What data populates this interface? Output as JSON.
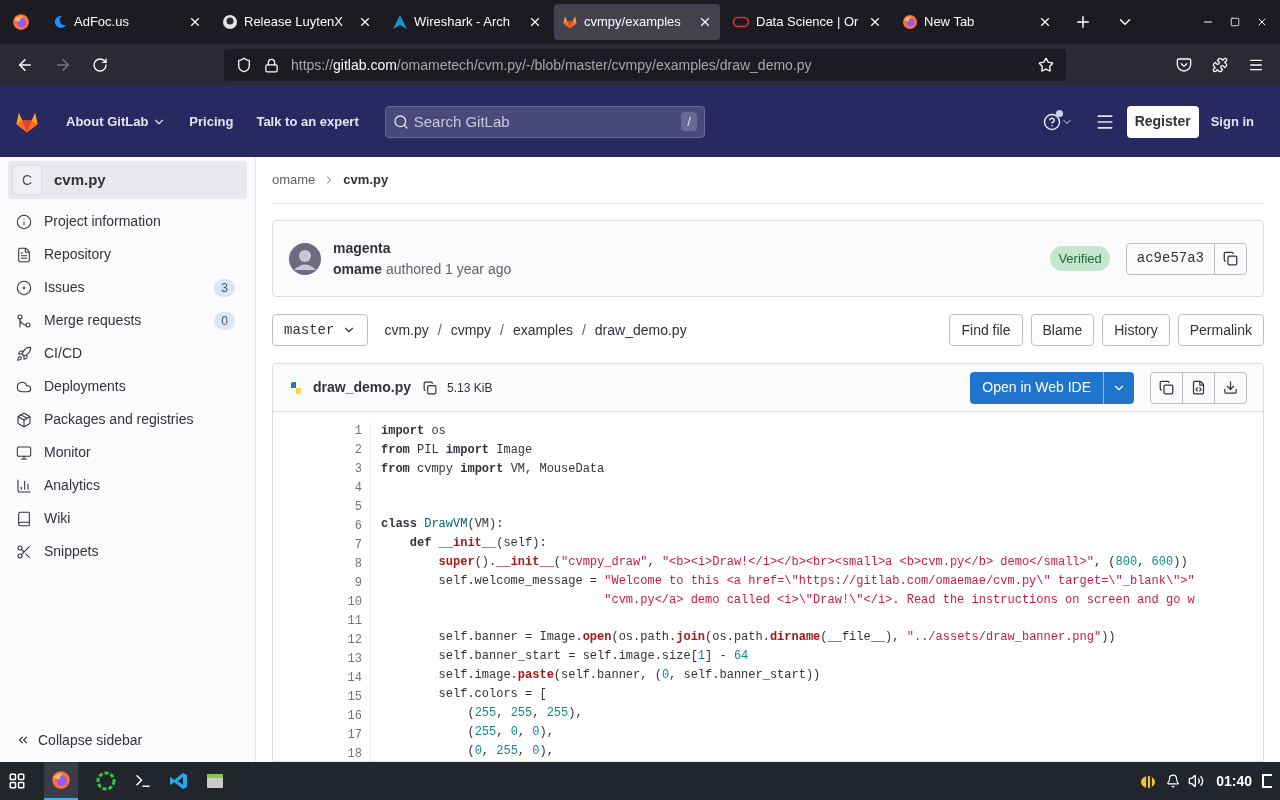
{
  "browser": {
    "tabs": [
      {
        "title": "AdFoc.us",
        "kind": "moon",
        "selected": false
      },
      {
        "title": "Release LuytenX",
        "kind": "github",
        "selected": false
      },
      {
        "title": "Wireshark - Arch",
        "kind": "arch",
        "selected": false
      },
      {
        "title": "cvmpy/examples",
        "kind": "gitlab",
        "selected": true
      },
      {
        "title": "Data Science | Or",
        "kind": "ring",
        "selected": false
      },
      {
        "title": "New Tab",
        "kind": "firefox",
        "selected": false
      }
    ],
    "url": "https://**gitlab.com**/omametech/cvm.py/-/blob/master/cvmpy/examples/draw_demo.py"
  },
  "header": {
    "nav": [
      {
        "label": "About GitLab",
        "dropdown": true
      },
      {
        "label": "Pricing",
        "dropdown": false
      },
      {
        "label": "Talk to an expert",
        "dropdown": false
      }
    ],
    "search": {
      "placeholder": "Search GitLab",
      "shortcut": "/"
    },
    "register": "Register",
    "sign_in": "Sign in"
  },
  "sidebar": {
    "project_letter": "C",
    "project": "cvm.py",
    "items": [
      {
        "label": "Project information",
        "kind": "info"
      },
      {
        "label": "Repository",
        "kind": "doc"
      },
      {
        "label": "Issues",
        "kind": "issues",
        "count": "3"
      },
      {
        "label": "Merge requests",
        "kind": "merge",
        "count": "0"
      },
      {
        "label": "CI/CD",
        "kind": "rocket"
      },
      {
        "label": "Deployments",
        "kind": "deploy"
      },
      {
        "label": "Packages and registries",
        "kind": "package"
      },
      {
        "label": "Monitor",
        "kind": "monitor"
      },
      {
        "label": "Analytics",
        "kind": "chart"
      },
      {
        "label": "Wiki",
        "kind": "book"
      },
      {
        "label": "Snippets",
        "kind": "snippet"
      }
    ],
    "collapse": "Collapse sidebar"
  },
  "breadcrumb": [
    "omame",
    "cvm.py"
  ],
  "commit": {
    "title": "magenta",
    "author": "omame",
    "meta": "authored 1 year ago",
    "badge": "Verified",
    "sha": "ac9e57a3"
  },
  "branch": "master",
  "path": [
    {
      "label": "cvm.py"
    },
    {
      "sep": "/",
      "label": "cvmpy"
    },
    {
      "sep": "/",
      "label": "examples"
    },
    {
      "sep": "/",
      "label": "draw_demo.py"
    }
  ],
  "actions": [
    "Find file",
    "Blame",
    "History",
    "Permalink"
  ],
  "file": {
    "name": "draw_demo.py",
    "size": "5.13 KiB",
    "open_ide": "Open in Web IDE"
  },
  "code": [
    {
      "n": "1",
      "t": [
        {
          "kind": "kw",
          "text": "import"
        },
        {
          "kind": "p",
          "text": " os"
        }
      ]
    },
    {
      "n": "2",
      "t": [
        {
          "kind": "kw",
          "text": "from"
        },
        {
          "kind": "p",
          "text": " PIL "
        },
        {
          "kind": "kw",
          "text": "import"
        },
        {
          "kind": "p",
          "text": " Image"
        }
      ]
    },
    {
      "n": "3",
      "t": [
        {
          "kind": "kw",
          "text": "from"
        },
        {
          "kind": "p",
          "text": " cvmpy "
        },
        {
          "kind": "kw",
          "text": "import"
        },
        {
          "kind": "p",
          "text": " VM, MouseData"
        }
      ]
    },
    {
      "n": "4"
    },
    {
      "n": "5"
    },
    {
      "n": "6",
      "t": [
        {
          "kind": "kw",
          "text": "class "
        },
        {
          "kind": "cls",
          "text": "DrawVM"
        },
        {
          "kind": "p",
          "text": "(VM):"
        }
      ]
    },
    {
      "n": "7",
      "t": [
        {
          "kind": "kw",
          "text": "    def "
        },
        {
          "kind": "fn",
          "text": "__init__"
        },
        {
          "kind": "p",
          "text": "(self):"
        }
      ]
    },
    {
      "n": "8",
      "t": [
        {
          "kind": "fn",
          "text": "        super"
        },
        {
          "kind": "p",
          "text": "()."
        },
        {
          "kind": "fn",
          "text": "__init__"
        },
        {
          "kind": "p",
          "text": "("
        },
        {
          "kind": "str",
          "text": "\"cvmpy_draw\""
        },
        {
          "kind": "p",
          "text": ", "
        },
        {
          "kind": "str",
          "text": "\"<b><i>Draw!</i></b><br><small>a <b>cvm.py</b> demo</small>\""
        },
        {
          "kind": "p",
          "text": ", ("
        },
        {
          "kind": "num",
          "text": "800"
        },
        {
          "kind": "p",
          "text": ", "
        },
        {
          "kind": "num",
          "text": "600"
        },
        {
          "kind": "p",
          "text": "))"
        }
      ]
    },
    {
      "n": "9",
      "t": [
        {
          "kind": "p",
          "text": "        self.welcome_message = "
        },
        {
          "kind": "str",
          "text": "\"Welcome to this <a href=\\\"https://gitlab.com/omaemae/cvm.py\\\" target=\\\"_blank\\\">\""
        }
      ]
    },
    {
      "n": "10",
      "t": [
        {
          "kind": "str",
          "text": "                               \"cvm.py</a> demo called <i>\\\"Draw!\\\"</i>. Read the instructions on screen and go w"
        }
      ]
    },
    {
      "n": "11"
    },
    {
      "n": "12",
      "t": [
        {
          "kind": "p",
          "text": "        self.banner = Image."
        },
        {
          "kind": "fn",
          "text": "open"
        },
        {
          "kind": "p",
          "text": "(os.path."
        },
        {
          "kind": "fn",
          "text": "join"
        },
        {
          "kind": "p",
          "text": "(os.path."
        },
        {
          "kind": "fn",
          "text": "dirname"
        },
        {
          "kind": "p",
          "text": "(__file__), "
        },
        {
          "kind": "str",
          "text": "\"../assets/draw_banner.png\""
        },
        {
          "kind": "p",
          "text": "))"
        }
      ]
    },
    {
      "n": "13",
      "t": [
        {
          "kind": "p",
          "text": "        self.banner_start = self.image.size["
        },
        {
          "kind": "num",
          "text": "1"
        },
        {
          "kind": "p",
          "text": "] - "
        },
        {
          "kind": "num",
          "text": "64"
        }
      ]
    },
    {
      "n": "14",
      "t": [
        {
          "kind": "p",
          "text": "        self.image."
        },
        {
          "kind": "fn",
          "text": "paste"
        },
        {
          "kind": "p",
          "text": "(self.banner, ("
        },
        {
          "kind": "num",
          "text": "0"
        },
        {
          "kind": "p",
          "text": ", self.banner_start))"
        }
      ]
    },
    {
      "n": "15",
      "t": [
        {
          "kind": "p",
          "text": "        self.colors = ["
        }
      ]
    },
    {
      "n": "16",
      "t": [
        {
          "kind": "p",
          "text": "            ("
        },
        {
          "kind": "num",
          "text": "255"
        },
        {
          "kind": "p",
          "text": ", "
        },
        {
          "kind": "num",
          "text": "255"
        },
        {
          "kind": "p",
          "text": ", "
        },
        {
          "kind": "num",
          "text": "255"
        },
        {
          "kind": "p",
          "text": "),"
        }
      ]
    },
    {
      "n": "17",
      "t": [
        {
          "kind": "p",
          "text": "            ("
        },
        {
          "kind": "num",
          "text": "255"
        },
        {
          "kind": "p",
          "text": ", "
        },
        {
          "kind": "num",
          "text": "0"
        },
        {
          "kind": "p",
          "text": ", "
        },
        {
          "kind": "num",
          "text": "0"
        },
        {
          "kind": "p",
          "text": "),"
        }
      ]
    },
    {
      "n": "18",
      "t": [
        {
          "kind": "p",
          "text": "            ("
        },
        {
          "kind": "num",
          "text": "0"
        },
        {
          "kind": "p",
          "text": ", "
        },
        {
          "kind": "num",
          "text": "255"
        },
        {
          "kind": "p",
          "text": ", "
        },
        {
          "kind": "num",
          "text": "0"
        },
        {
          "kind": "p",
          "text": "),"
        }
      ]
    }
  ],
  "taskbar": {
    "time": "01:40"
  }
}
